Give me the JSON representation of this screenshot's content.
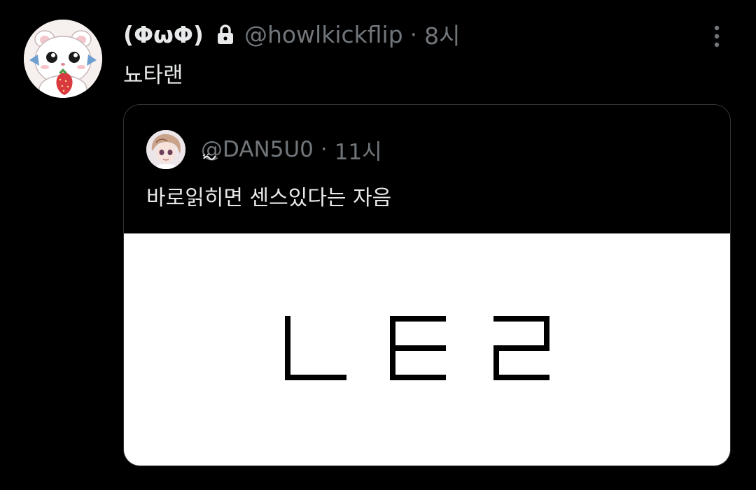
{
  "tweet": {
    "display_name": "(ΦωΦ)",
    "handle": "@howlkickflip",
    "dot": "·",
    "time": "8시",
    "text": "뇨타랜",
    "avatar_icon": "hamster-strawberry-avatar",
    "lock_icon": "lock-icon",
    "more_icon": "more-vertical-icon"
  },
  "quote": {
    "handle": "@DAN5U0",
    "dot": "·",
    "time": "11시",
    "text": "바로읽히면 센스있다는 자음",
    "avatar_icon": "anime-character-avatar",
    "squiggle_icon": "squiggle-icon",
    "image_text": "ㄴㅌㄹ"
  },
  "colors": {
    "background": "#000000",
    "primary_text": "#e7e9ea",
    "secondary_text": "#71767b",
    "border": "#2f3336",
    "media_background": "#ffffff"
  }
}
